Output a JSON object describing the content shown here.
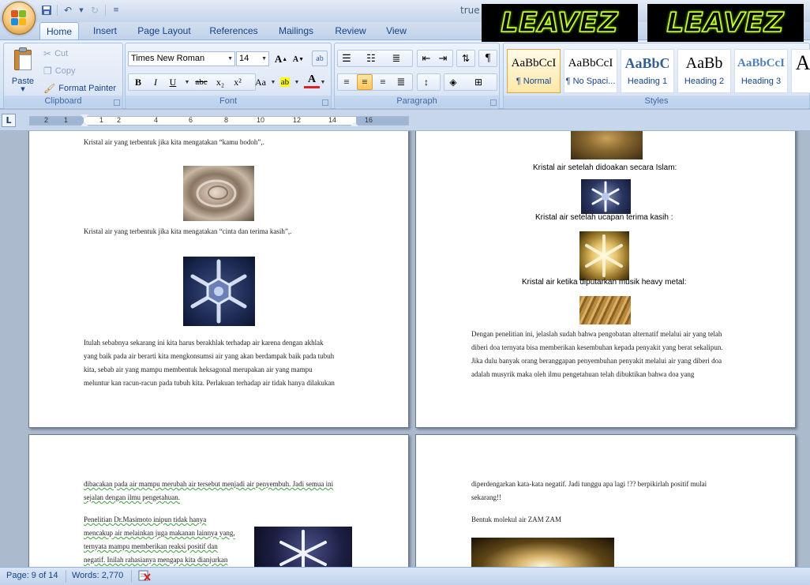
{
  "window": {
    "title": "true"
  },
  "quick_access": {
    "save_icon": "save-icon",
    "undo_icon": "undo-icon",
    "redo_icon": "redo-icon"
  },
  "banners": [
    {
      "text": "LEAVEZ"
    },
    {
      "text": "LEAVEZ"
    }
  ],
  "tabs": [
    "Home",
    "Insert",
    "Page Layout",
    "References",
    "Mailings",
    "Review",
    "View"
  ],
  "active_tab": "Home",
  "clipboard": {
    "group_label": "Clipboard",
    "paste": "Paste",
    "cut": "Cut",
    "copy": "Copy",
    "format_painter": "Format Painter"
  },
  "font": {
    "group_label": "Font",
    "family": "Times New Roman",
    "size": "14",
    "buttons": {
      "bold": "B",
      "italic": "I",
      "underline": "U",
      "strike": "abc",
      "sub": "x₂",
      "sup": "x²",
      "change_case": "Aa",
      "grow": "A",
      "shrink": "A"
    }
  },
  "paragraph": {
    "group_label": "Paragraph"
  },
  "styles": {
    "group_label": "Styles",
    "items": [
      {
        "sample": "AaBbCcI",
        "name": "¶ Normal"
      },
      {
        "sample": "AaBbCcI",
        "name": "¶ No Spaci..."
      },
      {
        "sample": "AaBbC",
        "name": "Heading 1"
      },
      {
        "sample": "AaBb",
        "name": "Heading 2"
      },
      {
        "sample": "AaBbCcI",
        "name": "Heading 3"
      },
      {
        "sample": "A",
        "name": ""
      }
    ]
  },
  "ruler": {
    "numbers": [
      "2",
      "1",
      "1",
      "2",
      "4",
      "6",
      "8",
      "10",
      "12",
      "14",
      "16"
    ]
  },
  "pages": {
    "p1": {
      "caption1": "Kristal air yang terbentuk jika kita mengatakan “kamu bodoh”,.",
      "caption2": "Kristal air yang terbentuk jika kita mengatakan “cinta dan terima kasih”,.",
      "body_lines": [
        "Itulah sebabnya sekarang ini kita harus berakhlak terhadap air karena dengan akhlak",
        "yang baik pada air berarti  kita mengkonsumsi air yang akan berdampak baik pada tubuh",
        "kita, sebab air yang mampu membentuk heksagonal merupakan air yang mampu",
        "meluntur kan racun-racun pada tubuh kita. Perlakuan terhadap air tidak hanya dilakukan"
      ]
    },
    "p2": {
      "cap_islam": "Kristal air setelah didoakan secara Islam:",
      "cap_terima": "Kristal air setelah ucapan terima kasih :",
      "cap_metal": "Kristal air ketika diputarkan musik heavy metal:",
      "body_lines": [
        "Dengan penelitian ini, jelaslah sudah bahwa pengobatan alternatif melalui air yang telah",
        "diberi doa ternyata bisa memberikan kesembuhan kepada penyakit yang berat sekalipun.",
        "Jika dulu banyak orang beranggapan penyembuhan penyakit melalui air yang diberi doa",
        "adalah musyrik maka oleh ilmu pengetahuan telah dibuktikan bahwa doa yang"
      ]
    },
    "p3": {
      "lines": [
        "dibacakan pada air mampu merubah air tersebut menjadi air penyembuh. Jadi semua ini",
        "sejalan dengan ilmu pengetahuan."
      ],
      "para2": [
        "Penelitian Dr.Masimoto inipun tidak hanya",
        "mencakup air melainkan juga makanan lainnya yang,",
        "ternyata mampu memberikan reaksi positif dan",
        "negatif. Inilah rahasianya mengapa kita dianjurkan"
      ]
    },
    "p4": {
      "lines": [
        "diperdengarkan kata-kata negatif. Jadi tunggu apa lagi !?? berpikirlah positif mulai",
        "sekarang!!"
      ],
      "caption": "Bentuk molekul air ZAM ZAM"
    }
  },
  "status": {
    "page": "Page: 9 of 14",
    "words": "Words: 2,770"
  }
}
